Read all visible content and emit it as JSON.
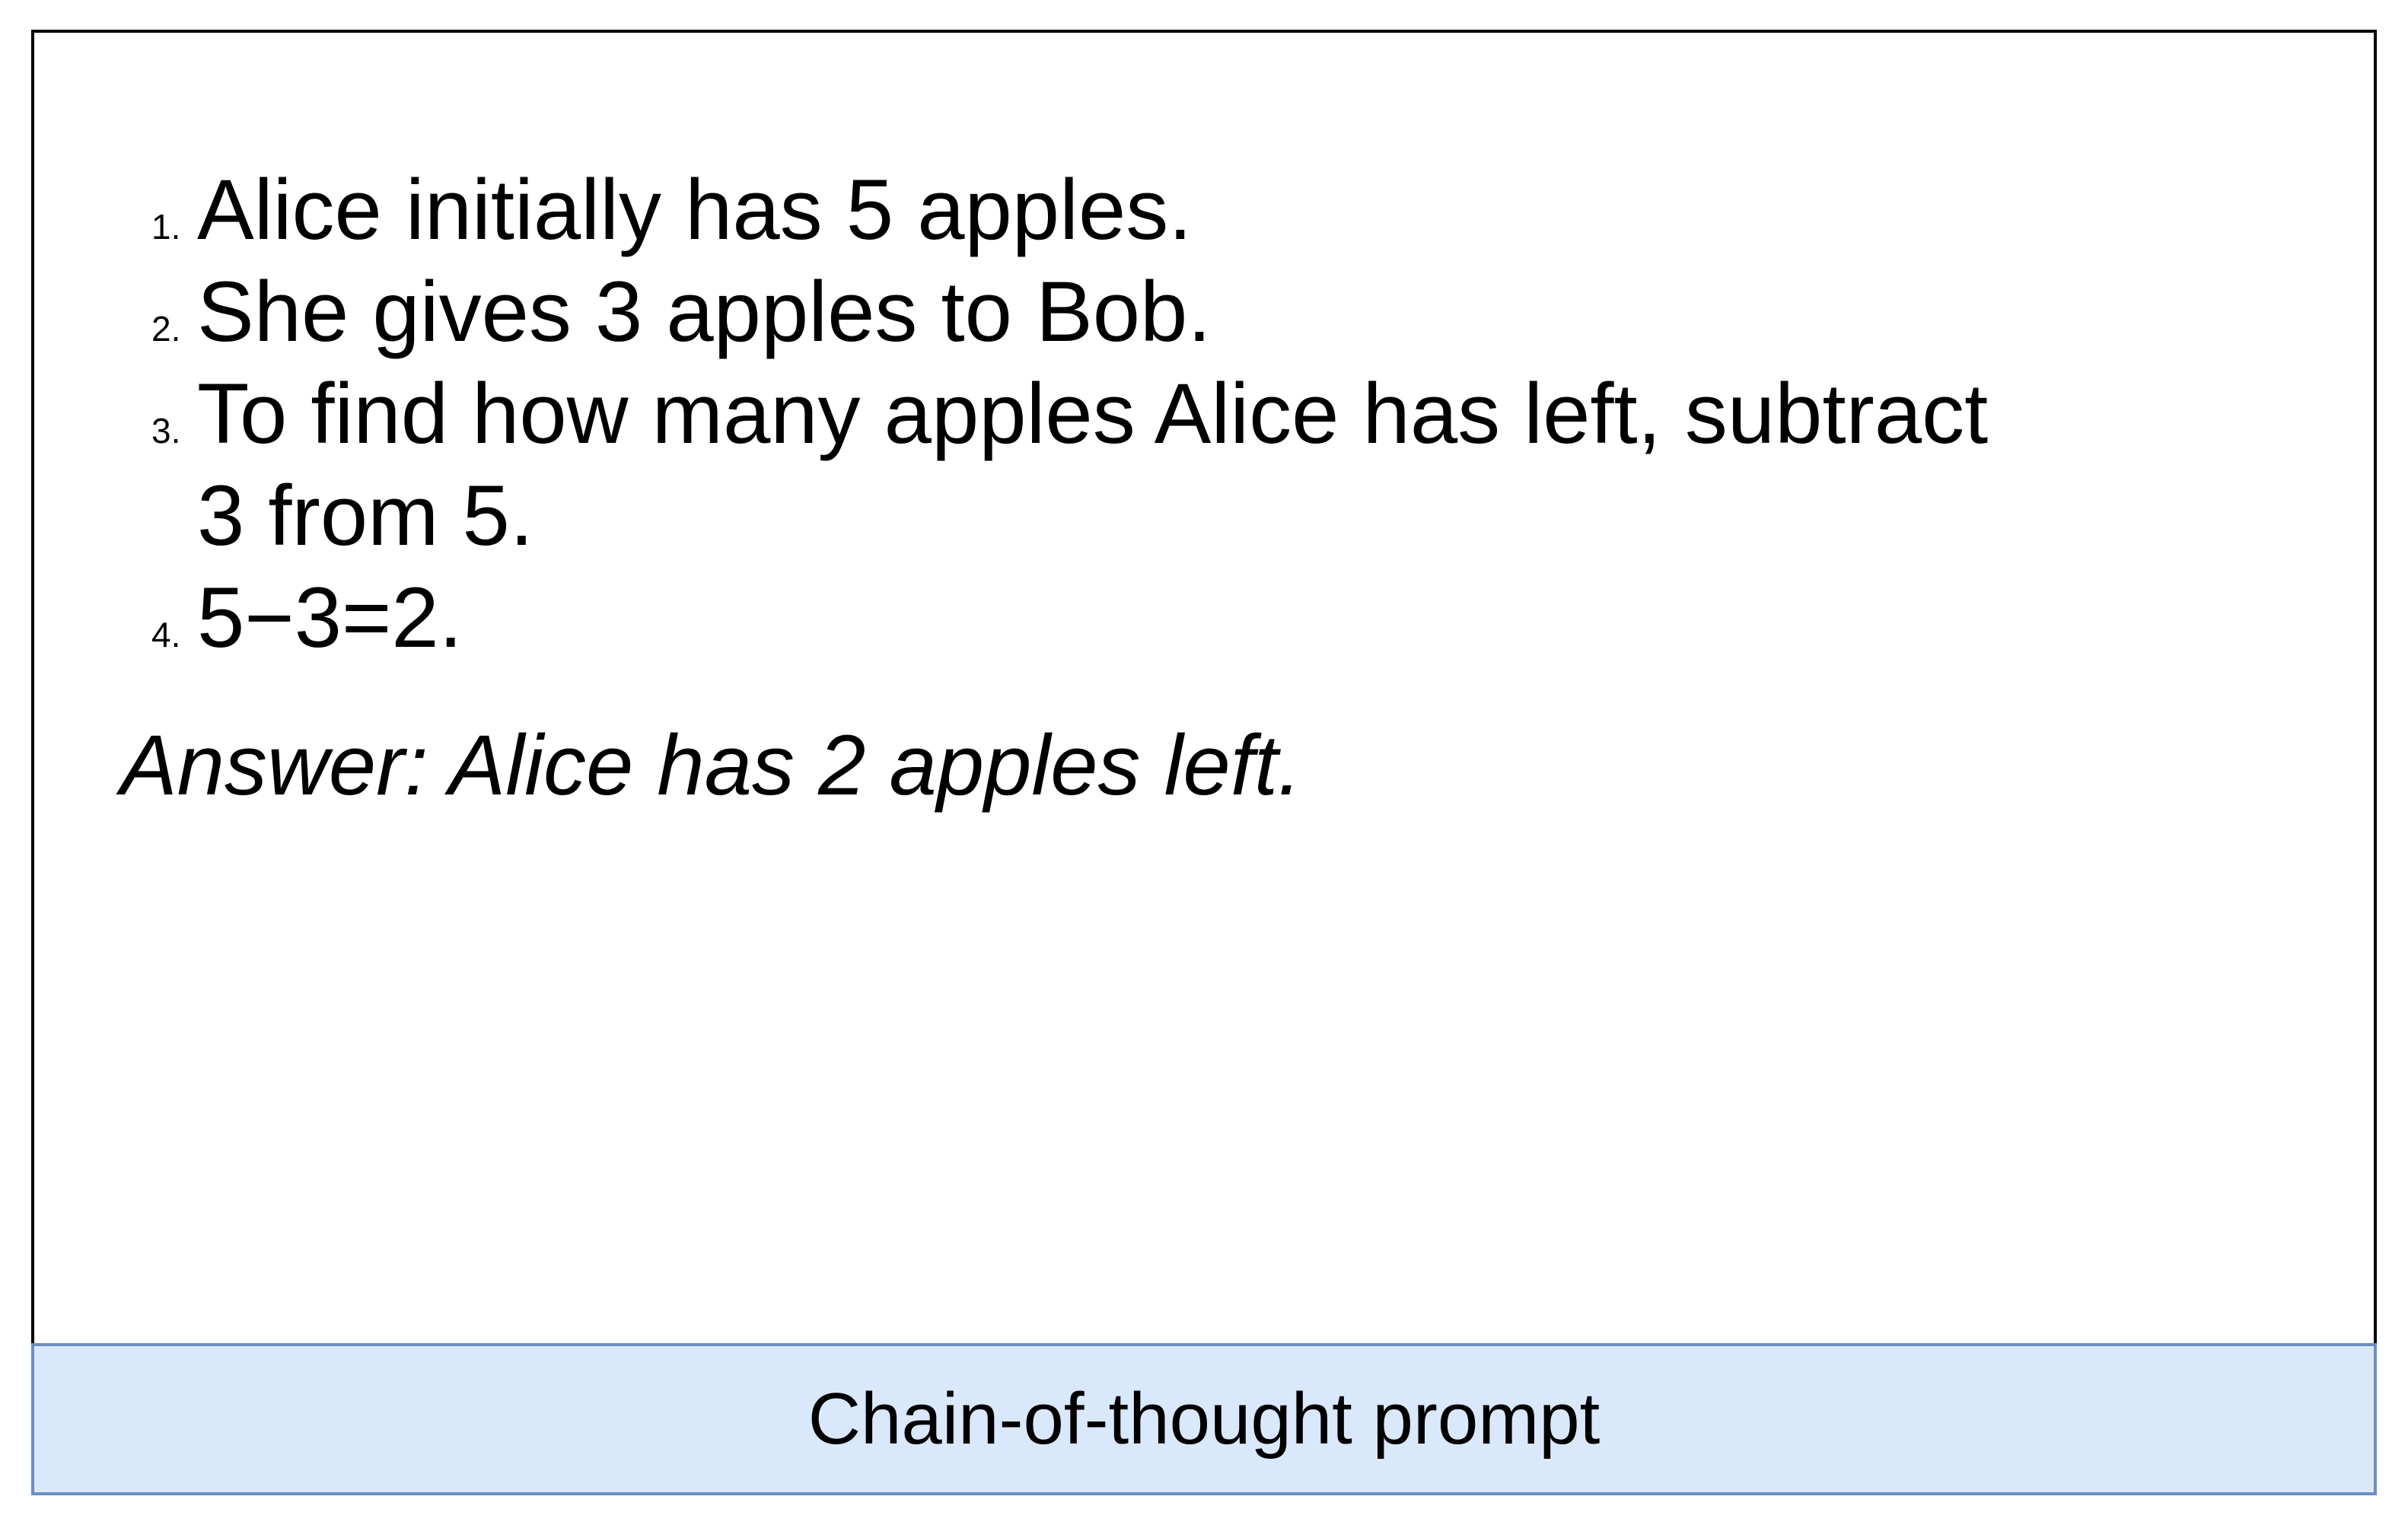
{
  "steps": [
    {
      "num": "1.",
      "text": "Alice initially has 5 apples."
    },
    {
      "num": "2.",
      "text": "She gives 3 apples to Bob."
    },
    {
      "num": "3.",
      "text": "To find how many apples Alice has left, subtract 3 from 5."
    },
    {
      "num": "4.",
      "text": "5−3=2."
    }
  ],
  "answer": "Answer: Alice has 2 apples left.",
  "caption": "Chain-of-thought prompt",
  "colors": {
    "caption_fill": "#dae8fc",
    "caption_border": "#6c8ebf",
    "frame_border": "#000000"
  }
}
